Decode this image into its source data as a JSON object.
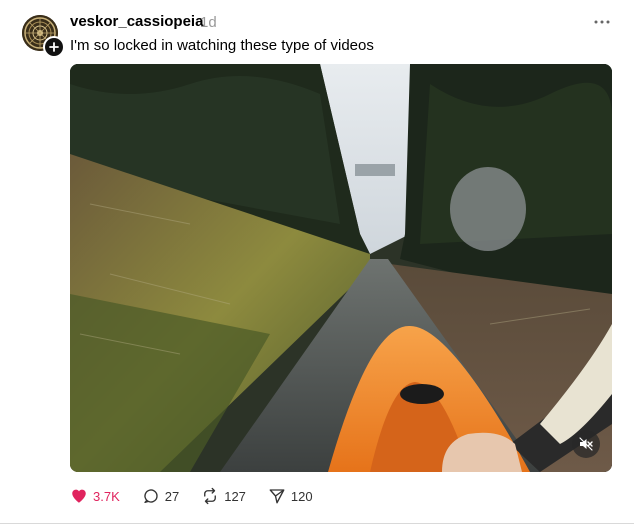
{
  "post": {
    "username": "veskor_cassiopeia",
    "timestamp": "1d",
    "caption": "I'm so locked in watching these type of videos"
  },
  "actions": {
    "likes": "3.7K",
    "comments": "27",
    "reposts": "127",
    "shares": "120"
  },
  "icons": {
    "like": "heart-icon",
    "comment": "comment-bubble-icon",
    "repost": "repost-icon",
    "share": "send-icon",
    "mute": "speaker-muted-icon",
    "more": "more-dots-icon",
    "follow": "plus-icon"
  },
  "colors": {
    "like": "#e0245e",
    "timestamp": "#999999",
    "text": "#000000"
  }
}
